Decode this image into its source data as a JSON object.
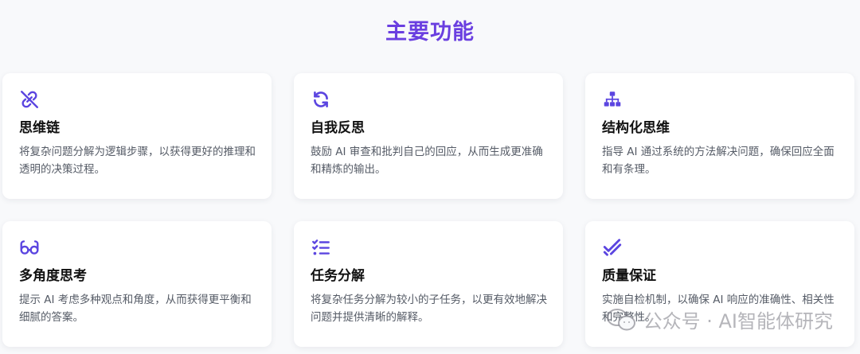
{
  "page": {
    "title": "主要功能"
  },
  "colors": {
    "accent": "#6a3fe0",
    "icon": "#5b45e0"
  },
  "features": [
    {
      "icon": "link-broken-icon",
      "title": "思维链",
      "desc": "将复杂问题分解为逻辑步骤，以获得更好的推理和透明的决策过程。"
    },
    {
      "icon": "refresh-icon",
      "title": "自我反思",
      "desc": "鼓励 AI 审查和批判自己的回应，从而生成更准确和精炼的输出。"
    },
    {
      "icon": "hierarchy-icon",
      "title": "结构化思维",
      "desc": "指导 AI 通过系统的方法解决问题，确保回应全面和有条理。"
    },
    {
      "icon": "glasses-icon",
      "title": "多角度思考",
      "desc": "提示 AI 考虑多种观点和角度，从而获得更平衡和细腻的答案。"
    },
    {
      "icon": "checklist-icon",
      "title": "任务分解",
      "desc": "将复杂任务分解为较小的子任务，以更有效地解决问题并提供清晰的解释。"
    },
    {
      "icon": "double-check-icon",
      "title": "质量保证",
      "desc": "实施自检机制，以确保 AI 响应的准确性、相关性和完整性。"
    }
  ],
  "watermark": {
    "text": "公众号 · AI智能体研究"
  }
}
